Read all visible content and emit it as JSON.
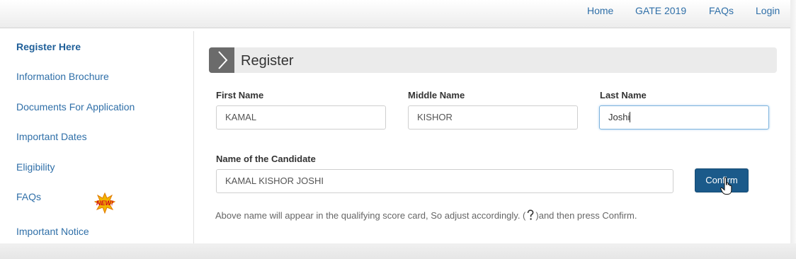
{
  "nav": {
    "home": "Home",
    "gate": "GATE 2019",
    "faqs": "FAQs",
    "login": "Login"
  },
  "sidebar": {
    "items": [
      {
        "label": "Register Here",
        "active": true
      },
      {
        "label": "Information Brochure"
      },
      {
        "label": "Documents For Application"
      },
      {
        "label": "Important Dates"
      },
      {
        "label": "Eligibility"
      },
      {
        "label": "FAQs"
      },
      {
        "label": "Important Notice"
      }
    ],
    "new_badge": "NEW!"
  },
  "register": {
    "title": "Register"
  },
  "form": {
    "first_name_label": "First Name",
    "first_name_value": "KAMAL",
    "middle_name_label": "Middle Name",
    "middle_name_value": "KISHOR",
    "last_name_label": "Last Name",
    "last_name_value": "Joshi",
    "candidate_label": "Name of the Candidate",
    "candidate_value": "KAMAL KISHOR JOSHI",
    "confirm_label": "Confirm",
    "help_before": "Above name will appear in the qualifying score card, So adjust accordingly. (",
    "help_after": ")and then press Confirm."
  },
  "colors": {
    "link": "#2f6fa8",
    "confirm_bg": "#1b5a8a",
    "badge": "#f2b400"
  },
  "icons": {
    "register_header": "chevron-right-icon",
    "help": "question-mark-icon",
    "cursor": "hand-pointer-icon"
  }
}
